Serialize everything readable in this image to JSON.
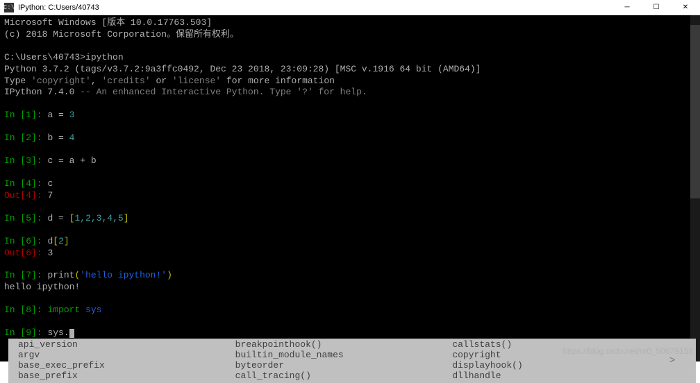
{
  "titlebar": {
    "icon_text": "C:\\",
    "title": "IPython: C:Users/40743"
  },
  "header": {
    "line1": "Microsoft Windows [版本 10.0.17763.503]",
    "line2": "(c) 2018 Microsoft Corporation。保留所有权利。"
  },
  "prompt_path": "C:\\Users\\40743>",
  "prompt_cmd": "ipython",
  "python_version": "Python 3.7.2 (tags/v3.7.2:9a3ffc0492, Dec 23 2018, 23:09:28) [MSC v.1916 64 bit (AMD64)]",
  "type_hint": {
    "a": "Type ",
    "b": "'copyright'",
    "c": ", ",
    "d": "'credits'",
    "e": " or ",
    "f": "'license'",
    "g": " for more information"
  },
  "ipython_banner": {
    "a": "IPython 7.4.0 ",
    "b": "-- An enhanced Interactive Python. Type '?' for help."
  },
  "cells": {
    "in1": {
      "label": "In [",
      "n": "1",
      "close": "]: ",
      "code": {
        "a": "a ",
        "op": "= ",
        "val": "3"
      }
    },
    "in2": {
      "label": "In [",
      "n": "2",
      "close": "]: ",
      "code": {
        "a": "b ",
        "op": "= ",
        "val": "4"
      }
    },
    "in3": {
      "label": "In [",
      "n": "3",
      "close": "]: ",
      "code": "c = a + b"
    },
    "in4": {
      "label": "In [",
      "n": "4",
      "close": "]: ",
      "code": "c"
    },
    "out4": {
      "label": "Out[",
      "n": "4",
      "close": "]: ",
      "val": "7"
    },
    "in5": {
      "label": "In [",
      "n": "5",
      "close": "]: ",
      "code": {
        "a": "d ",
        "op": "= ",
        "lb": "[",
        "vals": "1,2,3,4,5",
        "rb": "]"
      }
    },
    "in6": {
      "label": "In [",
      "n": "6",
      "close": "]: ",
      "code": {
        "a": "d",
        "lb": "[",
        "idx": "2",
        "rb": "]"
      }
    },
    "out6": {
      "label": "Out[",
      "n": "6",
      "close": "]: ",
      "val": "3"
    },
    "in7": {
      "label": "In [",
      "n": "7",
      "close": "]: ",
      "code": {
        "a": "print",
        "lp": "(",
        "str": "'hello ipython!'",
        "rp": ")"
      }
    },
    "out7text": "hello ipython!",
    "in8": {
      "label": "In [",
      "n": "8",
      "close": "]: ",
      "code": {
        "kw": "import ",
        "mod": "sys"
      }
    },
    "in9": {
      "label": "In [",
      "n": "9",
      "close": "]: ",
      "code": "sys."
    }
  },
  "autocomplete": {
    "col1": [
      "api_version",
      "argv",
      "base_exec_prefix",
      "base_prefix"
    ],
    "col2": [
      "breakpointhook()",
      "builtin_module_names",
      "byteorder",
      "call_tracing()"
    ],
    "col3": [
      "callstats()",
      "copyright",
      "displayhook()",
      "dllhandle"
    ],
    "scroll": ">"
  },
  "watermark": "https://blog.csdn.net/m0_50679158"
}
